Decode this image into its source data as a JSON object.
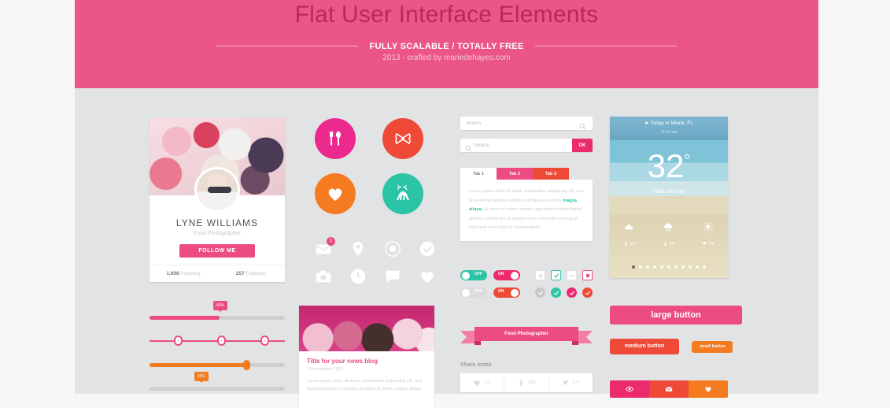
{
  "header": {
    "title": "Flat User Interface Elements",
    "subtitle": "FULLY SCALABLE / TOTALLY FREE",
    "credit": "2013 - crafted by mariedehayes.com"
  },
  "profile": {
    "name": "LYNE WILLIAMS",
    "role": "Food Photographer",
    "follow_label": "FOLLOW ME",
    "stats": [
      {
        "value": "1,698",
        "label": "Following"
      },
      {
        "value": "257",
        "label": "Followers"
      }
    ]
  },
  "circle_icons": [
    {
      "name": "cutlery-icon",
      "color": "#ec2a8d"
    },
    {
      "name": "bow-icon",
      "color": "#ee4a37"
    },
    {
      "name": "heart-icon",
      "color": "#f47b20"
    },
    {
      "name": "deer-icon",
      "color": "#2bc4a6"
    }
  ],
  "icon_grid": {
    "row1": [
      "envelope-icon",
      "map-pin-icon",
      "image-icon",
      "check-circle-icon"
    ],
    "row2": [
      "camera-icon",
      "clock-icon",
      "comment-icon",
      "heart-icon"
    ],
    "badge": "1"
  },
  "search": {
    "field1": {
      "value": "Search",
      "placeholder": "Search"
    },
    "field2": {
      "value": "Search",
      "placeholder": "Search"
    },
    "ok_label": "OK"
  },
  "tabs": {
    "items": [
      {
        "label": "Tab 1",
        "active": true
      },
      {
        "label": "Tab 2",
        "active": false
      },
      {
        "label": "Tab 3",
        "active": false
      }
    ],
    "body_part1": "Lorem ipsum dolor sit amet, consectetur adipisicing elit, sed do eiusmod tempor incididunt ut labore et dolore ",
    "body_link": "magna aliqua.",
    "body_part2": " Ut enim ad minim veniam, quis nostrud exercitation ullamco laboris nisi ut aliquip ex ea commodo consequat. Duis aute irure dolor in reprehenderit."
  },
  "toggles": [
    {
      "label": "OFF",
      "state": "off",
      "color": "#2bc4a6"
    },
    {
      "label": "ON",
      "state": "on",
      "color": "#ec2a6e"
    },
    {
      "label": "OFF",
      "state": "off",
      "color": "#dcdcdc"
    },
    {
      "label": "ON",
      "state": "on",
      "color": "#ee4a37"
    }
  ],
  "checkboxes": [
    {
      "name": "plus-checkbox",
      "color": "#c9c9c9"
    },
    {
      "name": "check-checkbox",
      "color": "#2bc4a6"
    },
    {
      "name": "minus-checkbox",
      "color": "#c9c9c9"
    },
    {
      "name": "stop-checkbox",
      "color": "#ec4c82"
    }
  ],
  "radios": [
    {
      "name": "check-radio-gray",
      "color": "#c9c9c9"
    },
    {
      "name": "check-radio-teal",
      "color": "#2bc4a6"
    },
    {
      "name": "check-radio-pink",
      "color": "#ec2a6e"
    },
    {
      "name": "check-radio-red",
      "color": "#ee4a37"
    }
  ],
  "ribbon": {
    "label": "Food Photographer"
  },
  "share": {
    "title": "Share icons",
    "items": [
      {
        "icon": "heart-icon",
        "count": "125"
      },
      {
        "icon": "facebook-icon",
        "count": "998"
      },
      {
        "icon": "twitter-icon",
        "count": "675"
      }
    ]
  },
  "weather": {
    "location": "Today in Miami, FL",
    "time": "11:14 am",
    "temperature": "32",
    "degree": "°",
    "condition": "Palm and sun",
    "forecast": [
      {
        "icon": "cloud-icon",
        "temp": "30°"
      },
      {
        "icon": "rain-cloud-icon",
        "temp": "24°"
      },
      {
        "icon": "sun-icon",
        "temp": "34°"
      }
    ],
    "dots": 11,
    "active_dot": 0
  },
  "sliders": [
    {
      "name": "progress-slider-pink",
      "fill": 52,
      "bubble": "40%",
      "color": "#ec4c82"
    },
    {
      "name": "range-slider-pink",
      "handles": 3,
      "color": "#ec4c82"
    },
    {
      "name": "progress-slider-orange",
      "fill": 72,
      "color": "#f47b20"
    },
    {
      "name": "progress-slider-orange-2",
      "fill": 38,
      "bubble": "30%",
      "color": "#f47b20"
    }
  ],
  "news": {
    "title": "Title for your news blog",
    "date": "12 november 2013",
    "text": "Lorem ipsum dolor sit amet, consectetur adipisicing elit. Sed eiusmod tempor incididunt ut labore et dolore magna aliqua."
  },
  "buttons": {
    "large": "large button",
    "medium": "medium button",
    "small": "small button"
  },
  "icon_bar": [
    {
      "icon": "eye-icon",
      "color": "#ec2a6e"
    },
    {
      "icon": "envelope-icon",
      "color": "#ee4a37"
    },
    {
      "icon": "heart-icon",
      "color": "#f47b20"
    }
  ]
}
